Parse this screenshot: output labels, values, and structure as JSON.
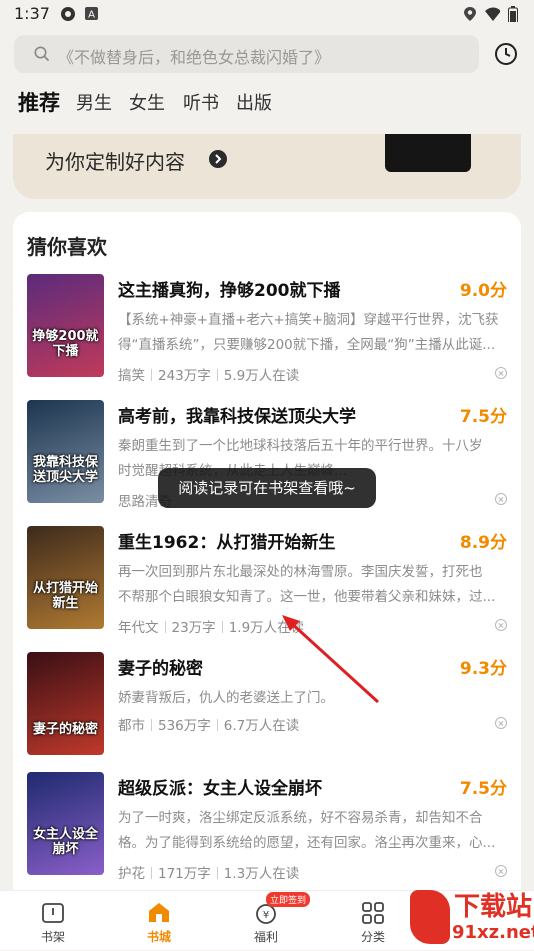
{
  "status_bar": {
    "time": "1:37",
    "left_icons": [
      "app-icon",
      "a-icon"
    ],
    "right_icons": [
      "location-icon",
      "wifi-icon",
      "battery-icon"
    ]
  },
  "search": {
    "placeholder": "《不做替身后，和绝色女总裁闪婚了》"
  },
  "tabs": [
    "推荐",
    "男生",
    "女生",
    "听书",
    "出版"
  ],
  "active_tab": "推荐",
  "banner": {
    "text": "为你定制好内容"
  },
  "section": {
    "title": "猜你喜欢"
  },
  "books": [
    {
      "title": "这主播真狗，挣够200就下播",
      "score": "9.0分",
      "desc_lines": [
        "【系统+神豪+直播+老六+搞笑+脑洞】穿越平行世界，沈飞获",
        "得“直播系统”，只要赚够200就下播，全网最“狗”主播从此诞..."
      ],
      "genre": "搞笑",
      "words": "243万字",
      "readers": "5.9万人在读",
      "cover_text": "挣够200就下播",
      "cover_colors": [
        "#5b2b7c",
        "#c03a5a"
      ]
    },
    {
      "title": "高考前，我靠科技保送顶尖大学",
      "score": "7.5分",
      "desc_lines": [
        "秦朗重生到了一个比地球科技落后五十年的平行世界。十八岁",
        "时觉醒超科系统，从此走上人生巅峰..."
      ],
      "genre": "思路清奇",
      "words": "",
      "readers": "",
      "cover_text": "我靠科技保送顶尖大学",
      "cover_colors": [
        "#1d3550",
        "#7a8ea3"
      ]
    },
    {
      "title": "重生1962：从打猎开始新生",
      "score": "8.9分",
      "desc_lines": [
        "再一次回到那片东北最深处的林海雪原。李国庆发誓，打死也",
        "不帮那个白眼狼女知青了。这一世，他要带着父亲和妹妹，过..."
      ],
      "genre": "年代文",
      "words": "23万字",
      "readers": "1.9万人在读",
      "cover_text": "从打猎开始新生",
      "cover_colors": [
        "#3d2a1c",
        "#b07a32"
      ]
    },
    {
      "title": "妻子的秘密",
      "score": "9.3分",
      "desc_lines": [
        "娇妻背叛后，仇人的老婆送上了门。"
      ],
      "genre": "都市",
      "words": "536万字",
      "readers": "6.7万人在读",
      "cover_text": "妻子的秘密",
      "cover_colors": [
        "#3a0f14",
        "#c0392b"
      ]
    },
    {
      "title": "超级反派：女主人设全崩坏",
      "score": "7.5分",
      "desc_lines": [
        "为了一时爽，洛尘绑定反派系统，好不容易杀青，却告知不合",
        "格。为了能得到系统给的愿望，还有回家。洛尘再次重来，心..."
      ],
      "genre": "护花",
      "words": "171万字",
      "readers": "1.3万人在读",
      "cover_text": "女主人设全崩坏",
      "cover_colors": [
        "#1e2a6e",
        "#8a5fc9"
      ]
    }
  ],
  "toast": "阅读记录可在书架查看哦~",
  "nav": {
    "items": [
      {
        "label": "书架",
        "icon": "bookshelf-icon"
      },
      {
        "label": "书城",
        "icon": "bookstore-icon"
      },
      {
        "label": "福利",
        "icon": "welfare-icon",
        "badge": "立即签到"
      },
      {
        "label": "分类",
        "icon": "category-icon"
      }
    ],
    "active": "书城"
  },
  "watermark": {
    "title": "下载站",
    "url": "91xz.net"
  },
  "colors": {
    "accent": "#f28a00",
    "badge": "#ee3b2e",
    "arrow": "#e02020"
  }
}
